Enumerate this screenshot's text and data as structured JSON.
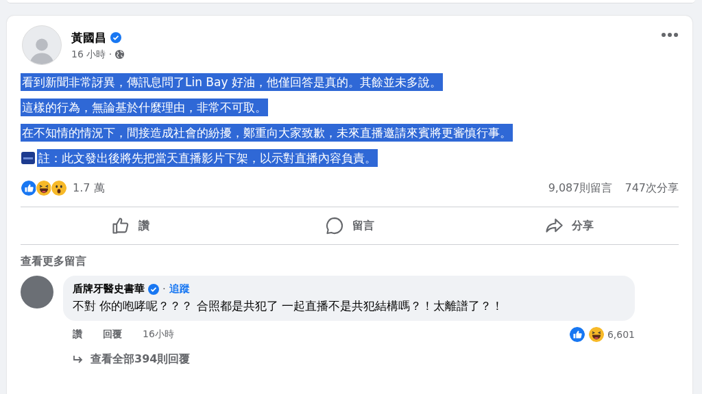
{
  "post": {
    "author": "黃國昌",
    "verified": true,
    "time": "16 小時 ·",
    "paragraphs": [
      {
        "text": "看到新聞非常訝異，傳訊息問了Lin Bay 好油，他僅回答是真的。其餘並未多說。",
        "highlighted": true,
        "emoji": false
      },
      {
        "text": "這樣的行為，無論基於什麼理由，非常不可取。",
        "highlighted": true,
        "emoji": false
      },
      {
        "text": "在不知情的情況下，間接造成社會的紛擾，鄭重向大家致歉，未來直播邀請來賓將更審慎行事。",
        "highlighted": true,
        "emoji": false
      },
      {
        "text": "註：此文發出後將先把當天直播影片下架，以示對直播內容負責。",
        "highlighted": true,
        "emoji": true
      }
    ],
    "reaction_count": "1.7 萬",
    "comment_count": "9,087則留言",
    "share_count": "747次分享",
    "actions": [
      {
        "kind": "like",
        "label": "讚"
      },
      {
        "kind": "comment",
        "label": "留言"
      },
      {
        "kind": "share",
        "label": "分享"
      }
    ]
  },
  "more_comments": "查看更多留言",
  "comment": {
    "author": "盾牌牙醫史書華",
    "verified": true,
    "separator": "·",
    "follow": "追蹤",
    "text": "不對 你的咆哮呢？？？ 合照都是共犯了 一起直播不是共犯結構嗎？！太離譜了？！",
    "like": "讚",
    "reply": "回覆",
    "time": "16小時",
    "reaction_count": "6,601",
    "view_replies": "查看全部394則回覆"
  }
}
